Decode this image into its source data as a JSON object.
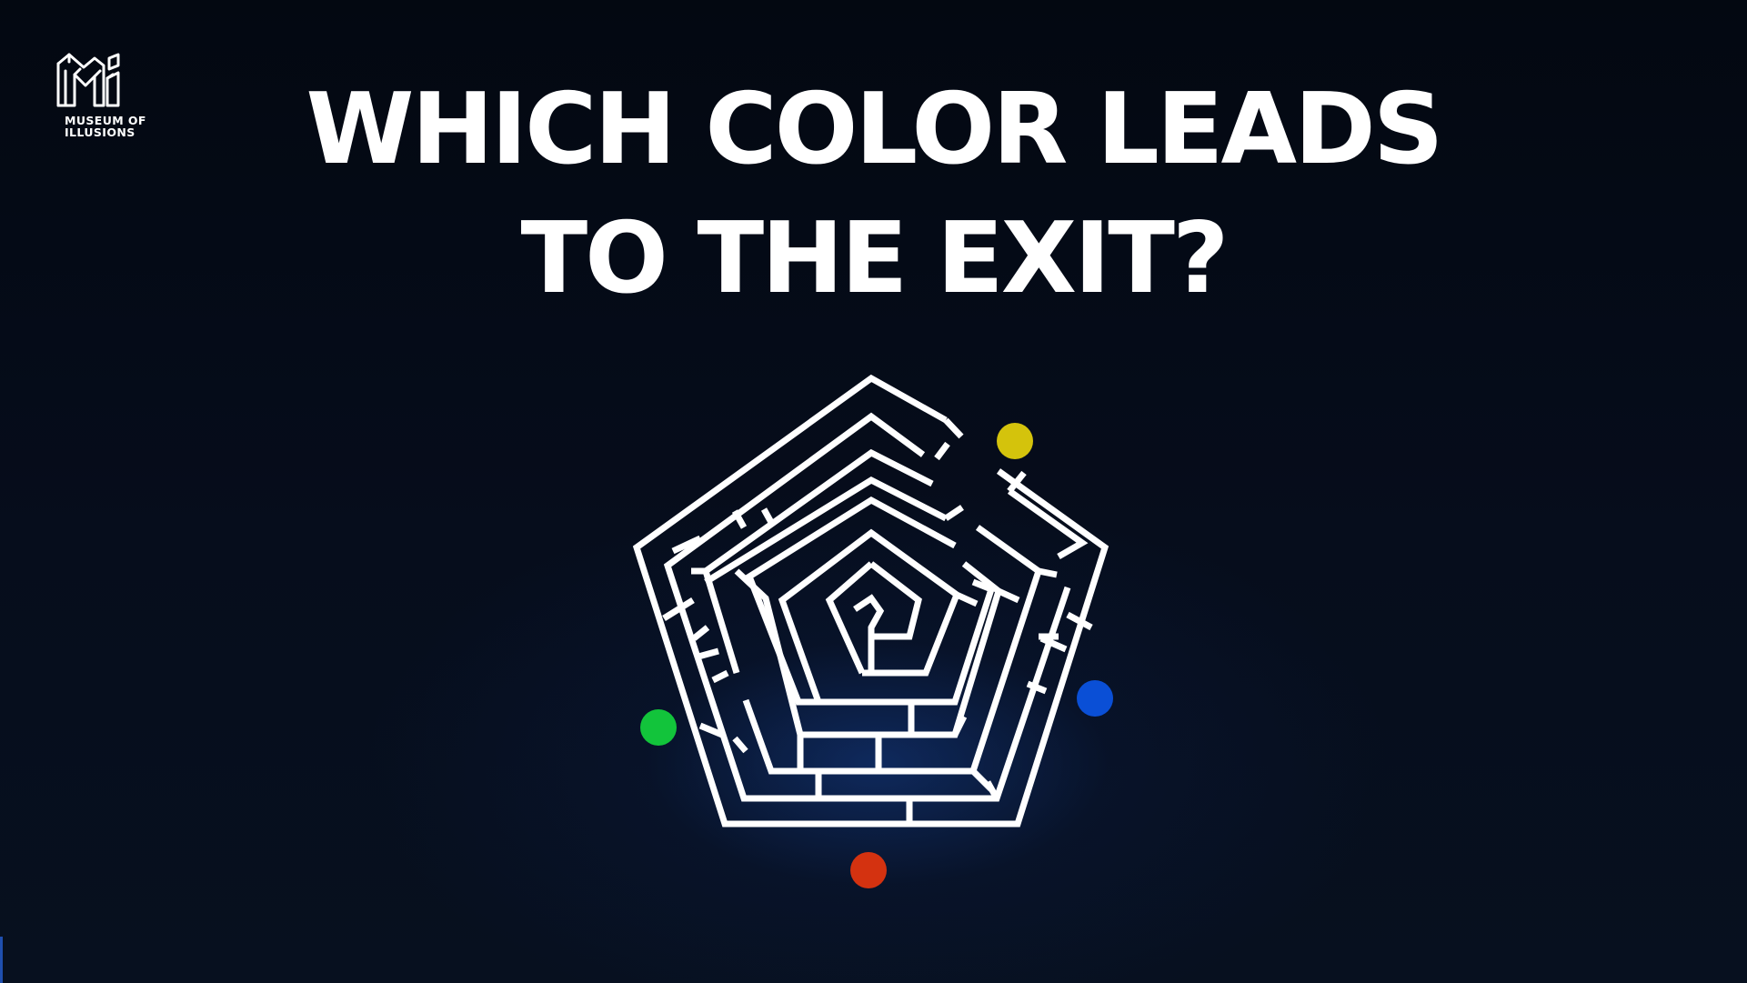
{
  "brand": {
    "logo_icon": "museum-of-illusions-logo",
    "name_line1": "MUSEUM OF",
    "name_line2": "ILLUSIONS"
  },
  "headline": {
    "line1": "WHICH COLOR LEADS",
    "line2": "TO THE EXIT?"
  },
  "maze": {
    "shape": "pentagon",
    "wall_color": "#ffffff",
    "start_markers": [
      {
        "name": "yellow",
        "color": "#d4c30c"
      },
      {
        "name": "blue",
        "color": "#0a4fd6"
      },
      {
        "name": "green",
        "color": "#12c43b"
      },
      {
        "name": "red",
        "color": "#d43210"
      }
    ]
  },
  "colors": {
    "background": "#060d1c",
    "glow": "#12347a",
    "text": "#ffffff"
  }
}
